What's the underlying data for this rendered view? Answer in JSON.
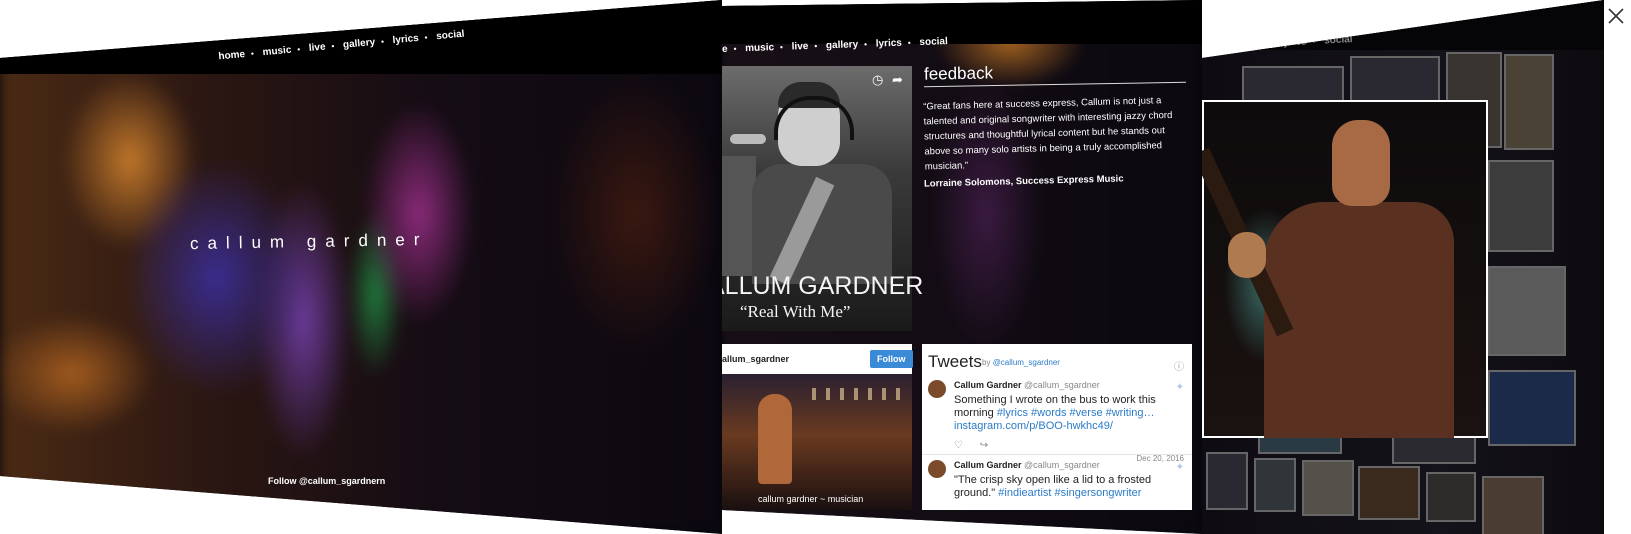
{
  "panel1": {
    "nav": [
      "home",
      "music",
      "live",
      "gallery",
      "lyrics",
      "social"
    ],
    "hero_name": "callum gardner",
    "follow_text": "Follow @callum_sgardnern"
  },
  "panel2": {
    "nav_partial": "e",
    "nav": [
      "music",
      "live",
      "gallery",
      "lyrics",
      "social"
    ],
    "album": {
      "title": "ALLUM GARDNER",
      "subtitle": "“Real With Me”",
      "clock_icon": "clock-icon",
      "share_icon": "share-icon"
    },
    "feedback": {
      "title": "feedback",
      "quote": "“Great fans here at success express, Callum is not just a talented and original songwriter with interesting jazzy chord structures and thoughtful lyrical content but he stands out above so many solo artists in being a truly accomplished musician.”",
      "author": "Lorraine Solomons, Success Express Music"
    },
    "instagram": {
      "username": "allum_sgardner",
      "follow_label": "Follow",
      "caption": "callum gardner ~ musician"
    },
    "tweets": {
      "header": "Tweets",
      "by_prefix": "by",
      "by_handle": "@callum_sgardner",
      "items": [
        {
          "name": "Callum Gardner",
          "handle": "@callum_sgardner",
          "text": "Something I wrote on the bus to work this morning",
          "tags": "#lyrics #words #verse #writing…",
          "link": "instagram.com/p/BOO-hwkhc49/",
          "date": "Dec 20, 2016"
        },
        {
          "name": "Callum Gardner",
          "handle": "@callum_sgardner",
          "text": "\"The crisp sky open like a lid to a frosted ground.\"",
          "tags": "#indieartist #singersongwriter"
        }
      ]
    }
  },
  "panel3": {
    "nav_partial": "ve",
    "nav": [
      "gallery",
      "lyrics",
      "social"
    ]
  },
  "close_icon": "close-icon"
}
